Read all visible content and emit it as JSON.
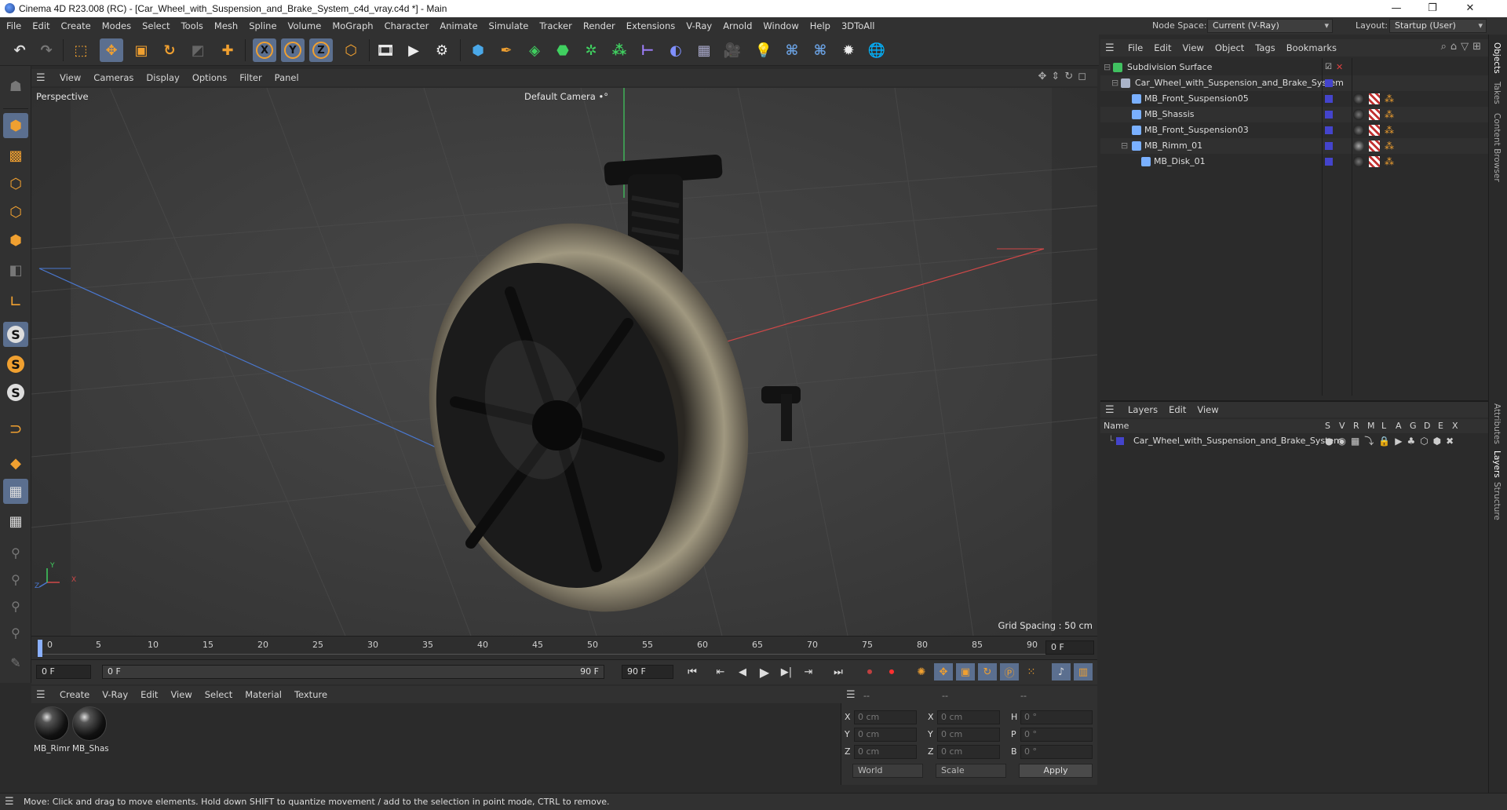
{
  "window": {
    "title": "Cinema 4D R23.008 (RC) - [Car_Wheel_with_Suspension_and_Brake_System_c4d_vray.c4d *] - Main",
    "minimize": "—",
    "maximize": "❐",
    "close": "✕"
  },
  "menubar": {
    "items": [
      "File",
      "Edit",
      "Create",
      "Modes",
      "Select",
      "Tools",
      "Mesh",
      "Spline",
      "Volume",
      "MoGraph",
      "Character",
      "Animate",
      "Simulate",
      "Tracker",
      "Render",
      "Extensions",
      "V-Ray",
      "Arnold",
      "Window",
      "Help",
      "3DToAll"
    ],
    "node_space_label": "Node Space:",
    "node_space_value": "Current (V-Ray)",
    "layout_label": "Layout:",
    "layout_value": "Startup (User)"
  },
  "toolbar": {
    "icons": [
      "undo-icon",
      "redo-icon",
      "live-selection-icon",
      "move-icon",
      "scale-icon",
      "rotate-icon",
      "recent-tools-icon",
      "add-icon",
      "x-axis-icon",
      "y-axis-icon",
      "z-axis-icon",
      "coordinate-system-icon",
      "render-view-icon",
      "render-picture-viewer-icon",
      "render-settings-icon",
      "cube-icon",
      "pen-icon",
      "subdivision-icon",
      "extrude-icon",
      "cloner-icon",
      "array-icon",
      "symmetry-icon",
      "deformer-icon",
      "floor-icon",
      "camera-icon",
      "light-icon",
      "python-icon",
      "python2-icon",
      "vray-settings-icon",
      "vray-globe-icon"
    ],
    "axis_x": "X",
    "axis_y": "Y",
    "axis_z": "Z"
  },
  "viewport": {
    "menu": [
      "View",
      "Cameras",
      "Display",
      "Options",
      "Filter",
      "Panel"
    ],
    "label": "Perspective",
    "camera": "Default Camera",
    "camera_suffix": "•°",
    "grid_spacing": "Grid Spacing : 50 cm",
    "axis_labels": {
      "x": "X",
      "y": "Y",
      "z": "Z"
    }
  },
  "timeline": {
    "ticks": [
      "0",
      "5",
      "10",
      "15",
      "20",
      "25",
      "30",
      "35",
      "40",
      "45",
      "50",
      "55",
      "60",
      "65",
      "70",
      "75",
      "80",
      "85",
      "90"
    ],
    "current_frame": "0 F",
    "start_field": "0 F",
    "range_start": "0 F",
    "range_end": "90 F",
    "end_field": "90 F"
  },
  "materials": {
    "menu": [
      "Create",
      "V-Ray",
      "Edit",
      "View",
      "Select",
      "Material",
      "Texture"
    ],
    "items": [
      {
        "label": "MB_Rimm"
      },
      {
        "label": "MB_Shas"
      }
    ]
  },
  "coords": {
    "header": [
      "--",
      "--",
      "--"
    ],
    "rows": [
      {
        "l1": "X",
        "v1": "0 cm",
        "l2": "X",
        "v2": "0 cm",
        "l3": "H",
        "v3": "0 °"
      },
      {
        "l1": "Y",
        "v1": "0 cm",
        "l2": "Y",
        "v2": "0 cm",
        "l3": "P",
        "v3": "0 °"
      },
      {
        "l1": "Z",
        "v1": "0 cm",
        "l2": "Z",
        "v2": "0 cm",
        "l3": "B",
        "v3": "0 °"
      }
    ],
    "world": "World",
    "scale": "Scale",
    "apply": "Apply"
  },
  "objects": {
    "menu": [
      "File",
      "Edit",
      "View",
      "Object",
      "Tags",
      "Bookmarks"
    ],
    "items": [
      {
        "name": "Subdivision Surface"
      },
      {
        "name": "Car_Wheel_with_Suspension_and_Brake_System"
      },
      {
        "name": "MB_Front_Suspension05"
      },
      {
        "name": "MB_Shassis"
      },
      {
        "name": "MB_Front_Suspension03"
      },
      {
        "name": "MB_Rimm_01"
      },
      {
        "name": "MB_Disk_01"
      }
    ]
  },
  "layers": {
    "menu": [
      "Layers",
      "Edit",
      "View"
    ],
    "header_name": "Name",
    "header_cols": [
      "S",
      "V",
      "R",
      "M",
      "L",
      "A",
      "G",
      "D",
      "E",
      "X"
    ],
    "items": [
      {
        "name": "Car_Wheel_with_Suspension_and_Brake_System"
      }
    ]
  },
  "right_tabs": [
    "Objects",
    "Takes",
    "Content Browser",
    "Attributes",
    "Layers",
    "Structure"
  ],
  "status": {
    "text": "Move: Click and drag to move elements. Hold down SHIFT to quantize movement / add to the selection in point mode, CTRL to remove."
  },
  "colors": {
    "accent": "#5b6f8f",
    "layer_color": "#4444cc",
    "axis_x": "#d04848",
    "axis_y": "#3fcf5f",
    "axis_z": "#4a78d0"
  }
}
